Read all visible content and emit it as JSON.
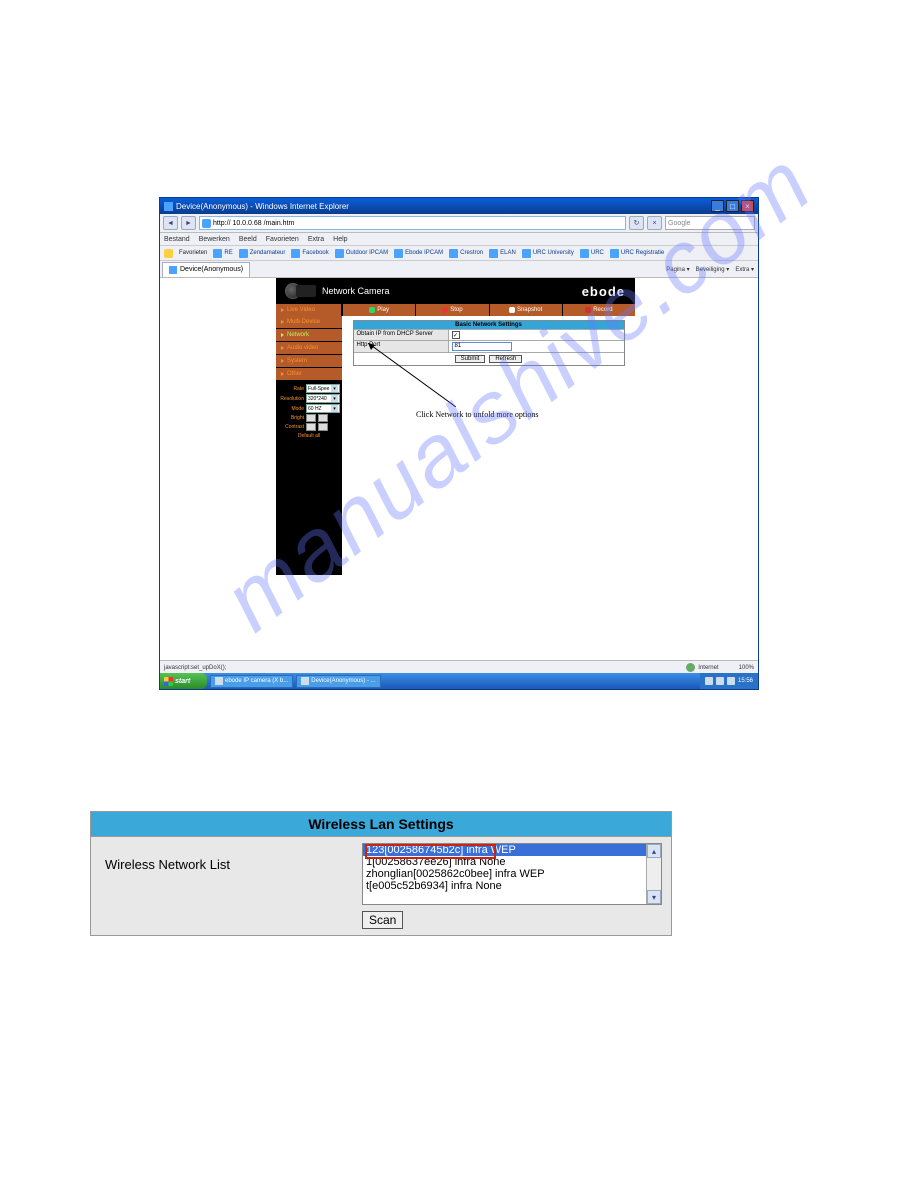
{
  "browser": {
    "window_title": "Device(Anonymous) - Windows Internet Explorer",
    "address": "http:// 10.0.0.68 /main.htm",
    "search_placeholder": "Google",
    "menu": [
      "Bestand",
      "Bewerken",
      "Beeld",
      "Favorieten",
      "Extra",
      "Help"
    ],
    "fav_label": "Favorieten",
    "fav_items": [
      "RE",
      "Zendamateur",
      "Facebook",
      "Outdoor IPCAM",
      "Ebode IPCAM",
      "Crestron",
      "ELAN",
      "URC University",
      "URC",
      "URC Registratie"
    ],
    "tab_label": "Device(Anonymous)",
    "cmdbar": [
      "Pagina ▾",
      "Beveiliging ▾",
      "Extra ▾"
    ],
    "status_left": "javascript:set_upDoX();",
    "status_zone": "Internet",
    "status_zoom": "100%"
  },
  "app": {
    "title": "Network Camera",
    "brand": "ebode",
    "actions": {
      "play": "Play",
      "stop": "Stop",
      "snap": "Snapshot",
      "rec": "Record"
    },
    "side_top": "Live Video",
    "side": [
      "Multi-Device",
      "Network",
      "Audio video",
      "System",
      "Other"
    ],
    "panel": {
      "rate": "Rate",
      "rate_val": "Full-Spee",
      "res": "Resolution",
      "res_val": "320*240",
      "mode": "Mode",
      "mode_val": "60 HZ",
      "bright": "Bright",
      "contrast": "Contrast",
      "default": "Default all"
    },
    "table": {
      "header": "Basic Network Settings",
      "r1k": "Obtain IP from DHCP Server",
      "r2k": "Http Port",
      "r2v": "81",
      "submit": "Submit",
      "refresh": "Refresh"
    },
    "callout": "Click Network to unfold more options"
  },
  "taskbar": {
    "start": "start",
    "btn1": "ebode IP camera (X b...",
    "btn2": "Device(Anonymous) - ...",
    "time": "15:56"
  },
  "panel2": {
    "title": "Wireless Lan Settings",
    "left": "Wireless Network List",
    "items": [
      "123[002586745b2c] infra WEP",
      "1[00258637ee26] infra None",
      "zhonglian[0025862c0bee] infra WEP",
      "t[e005c52b6934] infra None"
    ],
    "scan": "Scan"
  },
  "watermark": "manualshive.com"
}
